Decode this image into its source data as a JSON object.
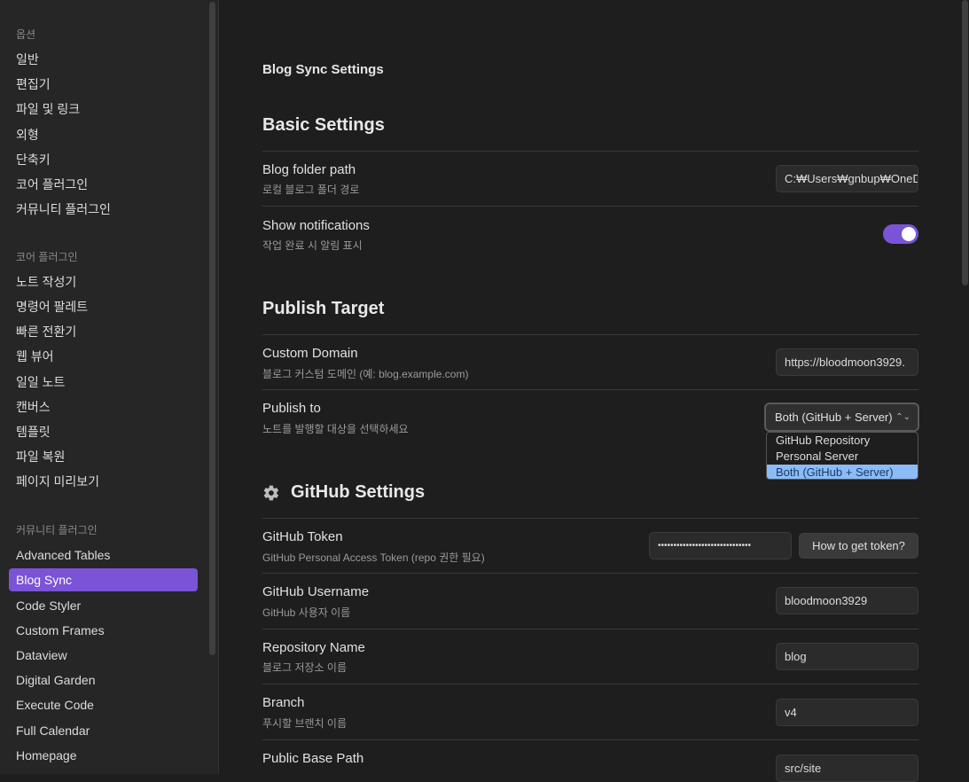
{
  "sidebar": {
    "groups": {
      "options": "옵션",
      "core_plugins": "코어 플러그인",
      "community_plugins": "커뮤니티 플러그인"
    },
    "options_items": [
      "일반",
      "편집기",
      "파일 및 링크",
      "외형",
      "단축키",
      "코어 플러그인",
      "커뮤니티 플러그인"
    ],
    "core_items": [
      "노트 작성기",
      "명령어 팔레트",
      "빠른 전환기",
      "웹 뷰어",
      "일일 노트",
      "캔버스",
      "템플릿",
      "파일 복원",
      "페이지 미리보기"
    ],
    "community_items": [
      "Advanced Tables",
      "Blog Sync",
      "Code Styler",
      "Custom Frames",
      "Dataview",
      "Digital Garden",
      "Execute Code",
      "Full Calendar",
      "Homepage"
    ],
    "active_item": "Blog Sync"
  },
  "main": {
    "plugin_title": "Blog Sync Settings",
    "basic": {
      "heading": "Basic Settings",
      "folder_name": "Blog folder path",
      "folder_desc": "로컬 블로그 폴더 경로",
      "folder_value": "C:₩Users₩gnbup₩OneD",
      "notif_name": "Show notifications",
      "notif_desc": "작업 완료 시 알림 표시",
      "notif_on": true
    },
    "publish": {
      "heading": "Publish Target",
      "domain_name": "Custom Domain",
      "domain_desc": "블로그 커스텀 도메인 (예: blog.example.com)",
      "domain_value": "https://bloodmoon3929.",
      "to_name": "Publish to",
      "to_desc": "노트를 발행할 대상을 선택하세요",
      "to_selected": "Both (GitHub + Server)",
      "to_options": [
        "GitHub Repository",
        "Personal Server",
        "Both (GitHub + Server)"
      ]
    },
    "github": {
      "heading": "GitHub Settings",
      "token_name": "GitHub Token",
      "token_desc": "GitHub Personal Access Token (repo 권한 필요)",
      "token_value": "••••••••••••••••••••••••••••••",
      "token_button": "How to get token?",
      "user_name": "GitHub Username",
      "user_desc": "GitHub 사용자 이름",
      "user_value": "bloodmoon3929",
      "repo_name": "Repository Name",
      "repo_desc": "블로그 저장소 이름",
      "repo_value": "blog",
      "branch_name": "Branch",
      "branch_desc": "푸시할 브랜치 이름",
      "branch_value": "v4",
      "base_name": "Public Base Path",
      "base_value": "src/site"
    }
  }
}
